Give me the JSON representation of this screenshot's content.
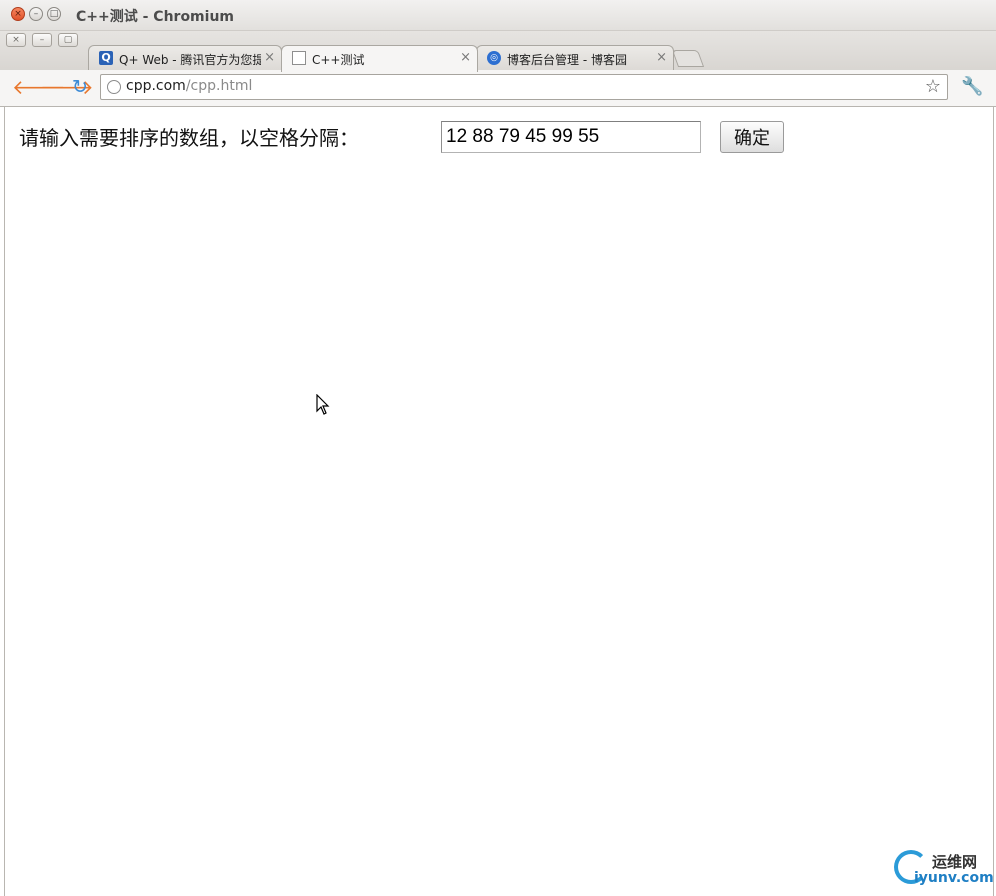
{
  "window": {
    "title": "C++测试 - Chromium"
  },
  "tabs": [
    {
      "label": "Q+ Web - 腾讯官方为您提供",
      "icon": "qq-icon",
      "close": "×"
    },
    {
      "label": "C++测试",
      "icon": "document-icon",
      "close": "×"
    },
    {
      "label": "博客后台管理 - 博客园",
      "icon": "cnblogs-icon",
      "close": "×"
    }
  ],
  "toolbar": {
    "url_host": "cpp.com",
    "url_path": "/cpp.html"
  },
  "form": {
    "prompt": "请输入需要排序的数组，以空格分隔：",
    "input_value": "12 88 79 45 99 55",
    "submit_label": "确定"
  },
  "watermark": {
    "cn": "运维网",
    "en": "iyunv.com"
  },
  "colors": {
    "close_button": "#e0522b",
    "nav_arrow": "#e8772d",
    "reload": "#3c8bd6",
    "watermark": "#2b9bd8"
  }
}
